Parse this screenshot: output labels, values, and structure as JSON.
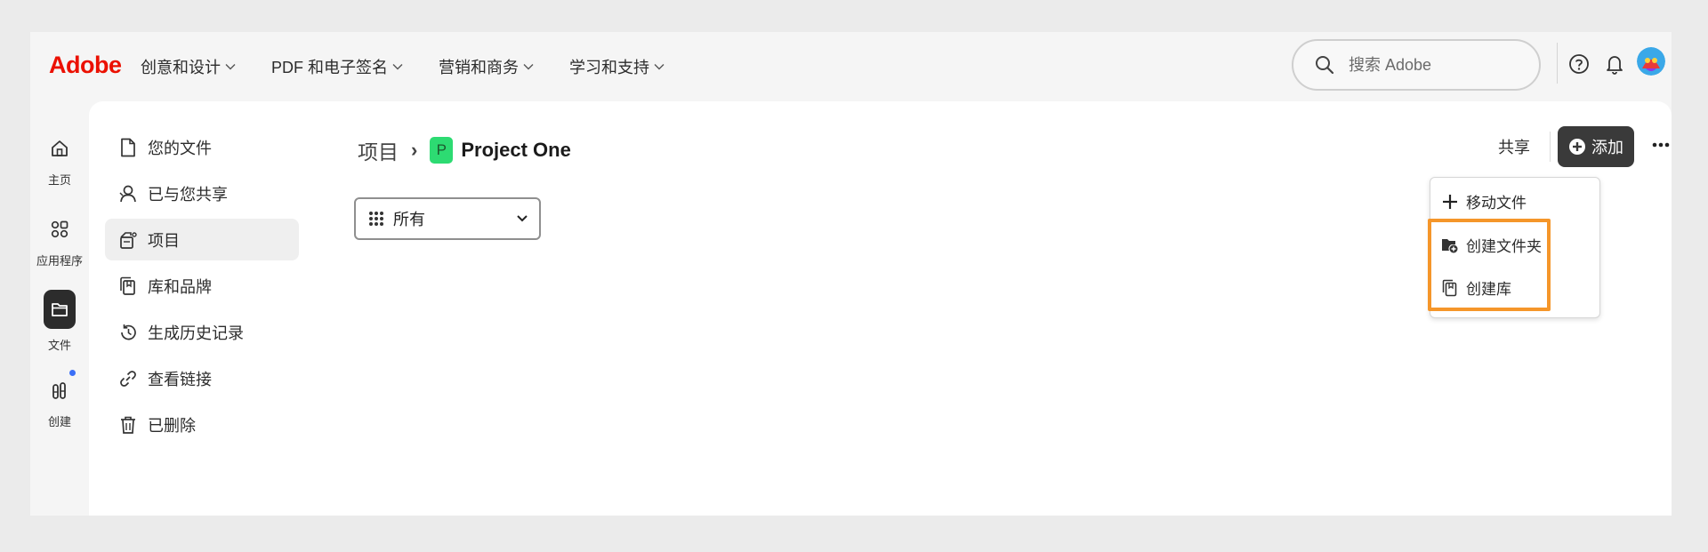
{
  "app": {
    "logo_text": "Adobe",
    "brand_color": "#eb1000"
  },
  "topnav": {
    "items": [
      {
        "label": "创意和设计"
      },
      {
        "label": "PDF 和电子签名"
      },
      {
        "label": "营销和商务"
      },
      {
        "label": "学习和支持"
      }
    ],
    "search_placeholder": "搜索 Adobe",
    "icons": [
      "help-icon",
      "bell-icon",
      "avatar"
    ]
  },
  "rail": {
    "items": [
      {
        "label": "主页",
        "icon": "home-icon"
      },
      {
        "label": "应用程序",
        "icon": "apps-icon"
      },
      {
        "label": "文件",
        "icon": "folder-icon",
        "active": true
      },
      {
        "label": "创建",
        "icon": "create-icon",
        "has_notification": true
      }
    ]
  },
  "sidenav": {
    "items": [
      {
        "label": "您的文件",
        "icon": "file-icon"
      },
      {
        "label": "已与您共享",
        "icon": "shared-user-icon"
      },
      {
        "label": "项目",
        "icon": "project-icon",
        "active": true
      },
      {
        "label": "库和品牌",
        "icon": "library-icon"
      },
      {
        "label": "生成历史记录",
        "icon": "history-icon"
      },
      {
        "label": "查看链接",
        "icon": "link-icon"
      },
      {
        "label": "已删除",
        "icon": "trash-icon"
      }
    ]
  },
  "breadcrumb": {
    "root": "项目",
    "separator": "›",
    "project_badge": "P",
    "current": "Project One",
    "badge_color": "#2ddb72"
  },
  "filter": {
    "selected": "所有"
  },
  "actions": {
    "share_label": "共享",
    "add_label": "添加"
  },
  "dropdown": {
    "items": [
      {
        "label": "移动文件",
        "icon": "plus-icon"
      },
      {
        "label": "创建文件夹",
        "icon": "new-folder-icon"
      },
      {
        "label": "创建库",
        "icon": "library-icon"
      }
    ],
    "highlight_color": "#f5962a"
  }
}
